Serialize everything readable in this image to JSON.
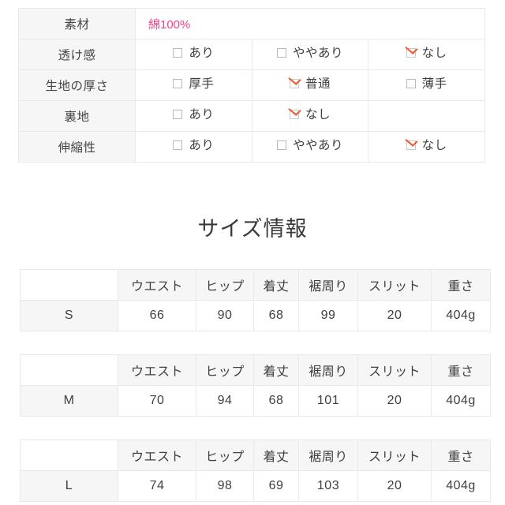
{
  "spec_table": {
    "rows": [
      {
        "label": "素材",
        "type": "text",
        "value": "綿100%",
        "value_color": "#f2438c"
      },
      {
        "label": "透け感",
        "type": "options",
        "options": [
          {
            "label": "あり",
            "checked": false
          },
          {
            "label": "ややあり",
            "checked": false
          },
          {
            "label": "なし",
            "checked": true
          }
        ]
      },
      {
        "label": "生地の厚さ",
        "type": "options",
        "options": [
          {
            "label": "厚手",
            "checked": false
          },
          {
            "label": "普通",
            "checked": true
          },
          {
            "label": "薄手",
            "checked": false
          }
        ]
      },
      {
        "label": "裏地",
        "type": "options",
        "options": [
          {
            "label": "あり",
            "checked": false
          },
          {
            "label": "なし",
            "checked": true
          },
          {
            "label": "",
            "checked": null
          }
        ]
      },
      {
        "label": "伸縮性",
        "type": "options",
        "options": [
          {
            "label": "あり",
            "checked": false
          },
          {
            "label": "ややあり",
            "checked": false
          },
          {
            "label": "なし",
            "checked": true
          }
        ]
      }
    ]
  },
  "size_section": {
    "title": "サイズ情報",
    "headers": [
      "",
      "ウエスト",
      "ヒップ",
      "着丈",
      "裾周り",
      "スリット",
      "重さ"
    ],
    "tables": [
      {
        "size": "S",
        "values": [
          "66",
          "90",
          "68",
          "99",
          "20",
          "404g"
        ]
      },
      {
        "size": "M",
        "values": [
          "70",
          "94",
          "68",
          "101",
          "20",
          "404g"
        ]
      },
      {
        "size": "L",
        "values": [
          "74",
          "98",
          "69",
          "103",
          "20",
          "404g"
        ]
      }
    ]
  },
  "colors": {
    "accent_pink": "#f2438c",
    "check_orange": "#f0562c",
    "header_bg": "#f6f6f6",
    "border": "#e9e9e9",
    "text": "#3f3f3f"
  }
}
